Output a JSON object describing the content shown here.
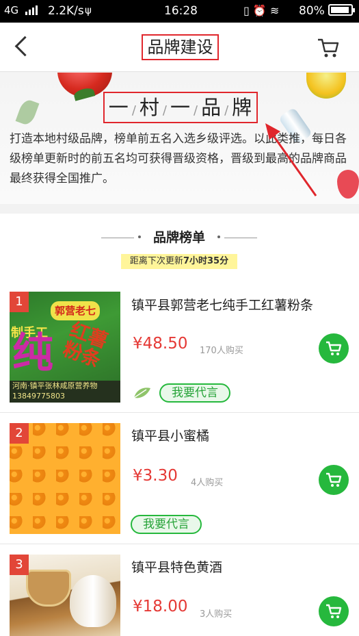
{
  "status_bar": {
    "network": "4G",
    "speed": "2.2K/s",
    "usb": "ψ",
    "time": "16:28",
    "battery": "80%"
  },
  "nav": {
    "title": "品牌建设"
  },
  "banner": {
    "slogan": [
      "一",
      "村",
      "一",
      "品",
      "牌"
    ],
    "description": "打造本地村级品牌，榜单前五名入选乡级评选。以此类推，每日各级榜单更新时的前五名均可获得晋级资格，晋级到最高的品牌商品最终获得全国推广。"
  },
  "ranking": {
    "title": "品牌榜单",
    "countdown_prefix": "距离下次更新",
    "countdown_value": "7小时35分"
  },
  "products": [
    {
      "rank": "1",
      "name": "镇平县郭营老七纯手工红薯粉条",
      "price": "¥48.50",
      "sold": "170人购买",
      "endorse_label": "我要代言",
      "image_text": {
        "brand": "郭营老七",
        "handmade": "制手工",
        "hongshu": "红薯粉条",
        "big": "纯",
        "contact": "河南·镇平张林咸原营养物 13849775803"
      }
    },
    {
      "rank": "2",
      "name": "镇平县小蜜橘",
      "price": "¥3.30",
      "sold": "4人购买",
      "endorse_label": "我要代言"
    },
    {
      "rank": "3",
      "name": "镇平县特色黄酒",
      "price": "¥18.00",
      "sold": "3人购买"
    }
  ],
  "colors": {
    "accent_green": "#26b83d",
    "price_red": "#e53935",
    "highlight_box": "#e0262c",
    "countdown_bg": "#fff59a",
    "rank_badge": "#e24638"
  },
  "icons": [
    "back-icon",
    "cart-icon",
    "signal-icon",
    "wifi-icon",
    "alarm-icon",
    "vibrate-icon",
    "battery-icon",
    "leaf-icon",
    "add-to-cart-icon"
  ]
}
